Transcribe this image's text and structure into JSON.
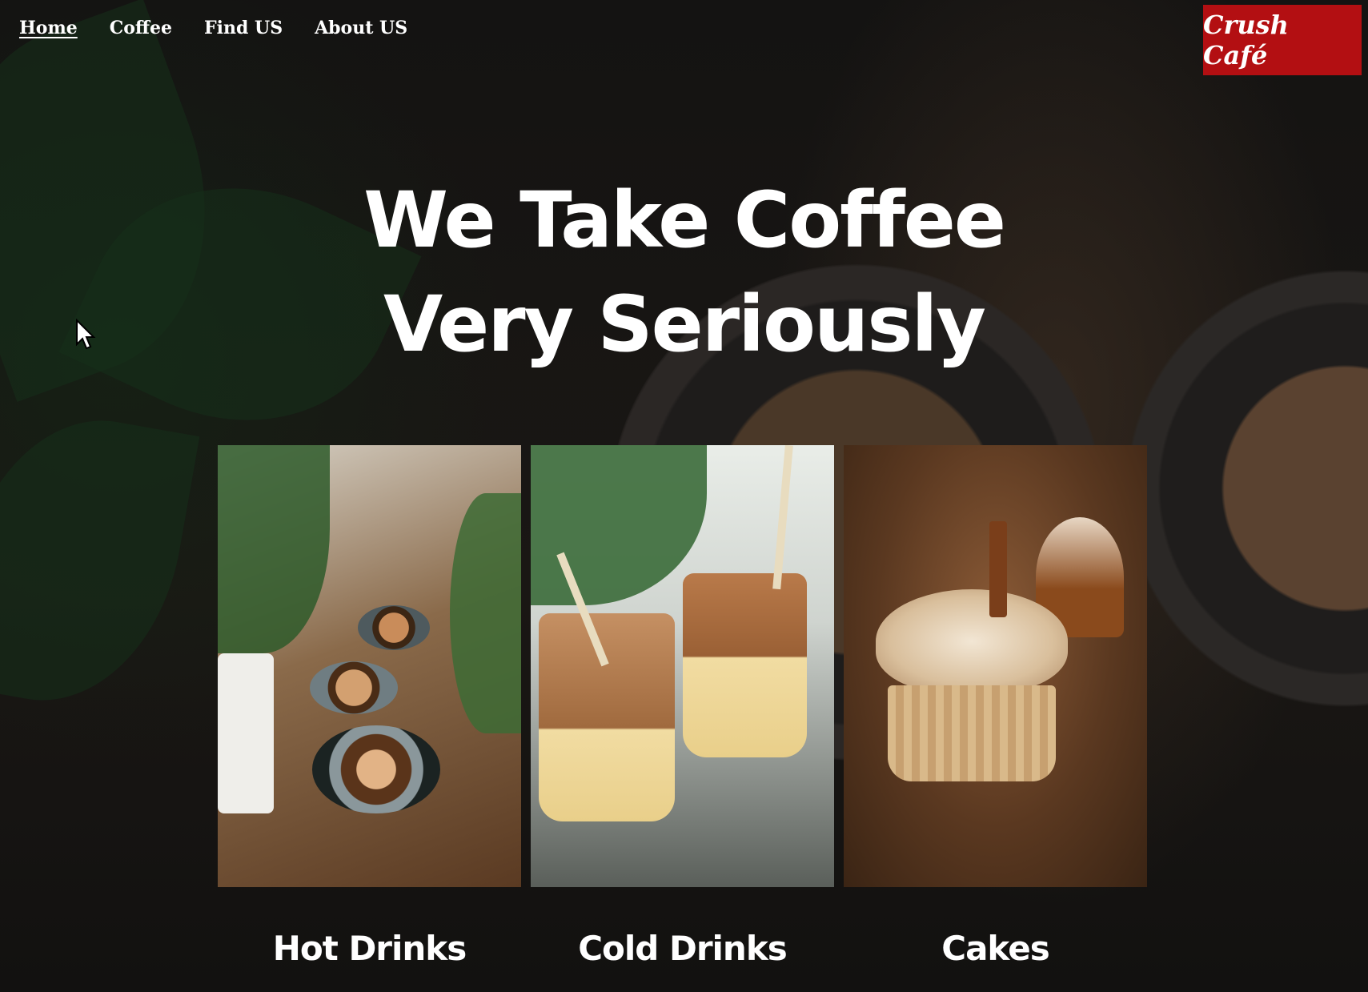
{
  "nav": {
    "items": [
      {
        "label": "Home",
        "active": true
      },
      {
        "label": "Coffee",
        "active": false
      },
      {
        "label": "Find US",
        "active": false
      },
      {
        "label": "About US",
        "active": false
      }
    ]
  },
  "brand": {
    "name": "Crush Café",
    "color": "#b30f12"
  },
  "hero": {
    "line1": "We Take Coffee",
    "line2": "Very Seriously"
  },
  "cards": [
    {
      "title": "Hot Drinks"
    },
    {
      "title": "Cold Drinks"
    },
    {
      "title": "Cakes"
    }
  ]
}
